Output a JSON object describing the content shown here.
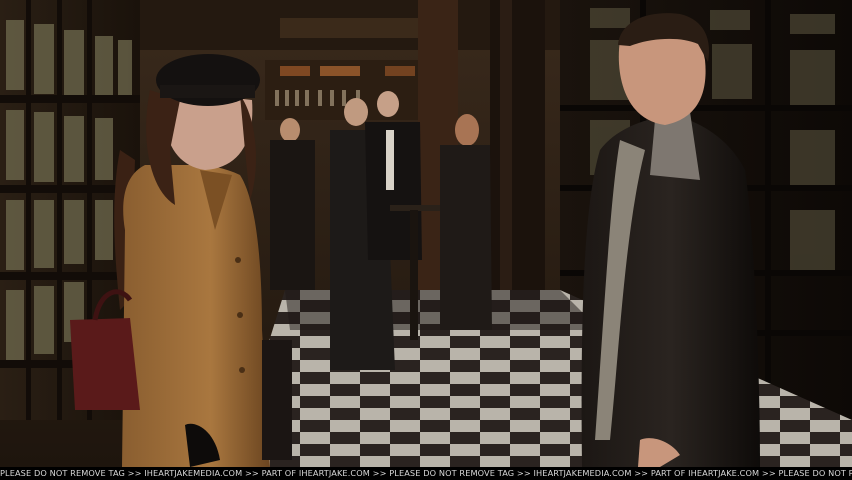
{
  "watermark": {
    "text": "PLEASE DO NOT REMOVE TAG >> IHEARTJAKEMEDIA.COM >> PART OF IHEARTJAKE.COM >> PLEASE DO NOT REMOVE TAG >> IHEARTJAKEMEDIA.COM >> PART OF IHEARTJAKE.COM >> PLEASE DO NOT REMOVE TAG >> IHEARTJAKE"
  }
}
